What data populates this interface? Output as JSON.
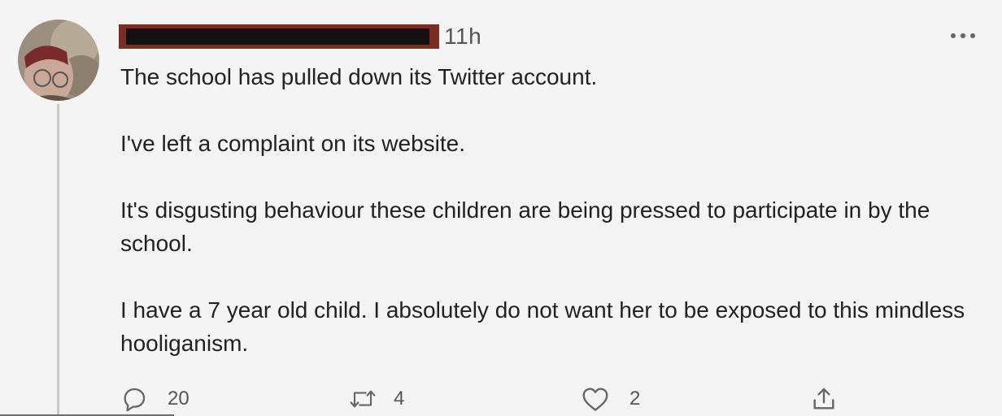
{
  "tweet": {
    "time": "11h",
    "paragraphs": [
      "The school has pulled down its Twitter account.",
      "I've left a complaint on its website.",
      "It's disgusting behaviour these children are being pressed to participate in by the school.",
      "I have a 7 year old child. I absolutely do not want her to be exposed to this mindless hooliganism."
    ],
    "actions": {
      "reply_count": "20",
      "retweet_count": "4",
      "like_count": "2"
    }
  },
  "icons": {
    "avatar": "avatar-photo",
    "more": "more-horizontal-icon",
    "reply": "reply-bubble-icon",
    "retweet": "retweet-icon",
    "like": "heart-icon",
    "share": "share-upload-icon"
  },
  "colors": {
    "background": "#f4f4f4",
    "text": "#222222",
    "muted": "#555555",
    "redaction": "#121212",
    "redaction_border": "#7d2c24"
  }
}
